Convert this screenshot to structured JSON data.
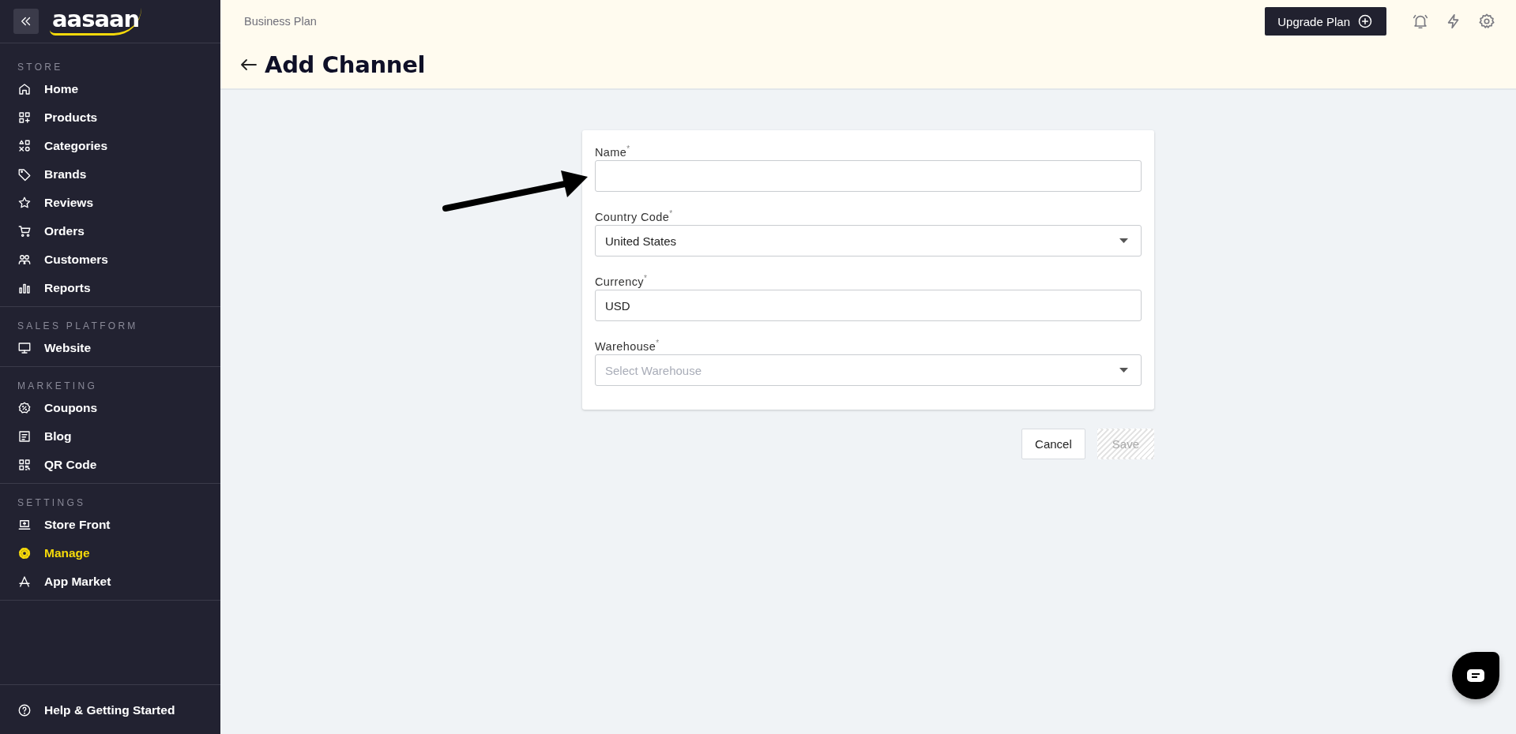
{
  "sidebar": {
    "logo": "aasaan",
    "sections": [
      {
        "title": "STORE",
        "items": [
          {
            "label": "Home",
            "selected": false
          },
          {
            "label": "Products",
            "selected": false
          },
          {
            "label": "Categories",
            "selected": false
          },
          {
            "label": "Brands",
            "selected": false
          },
          {
            "label": "Reviews",
            "selected": false
          },
          {
            "label": "Orders",
            "selected": false
          },
          {
            "label": "Customers",
            "selected": false
          },
          {
            "label": "Reports",
            "selected": false
          }
        ]
      },
      {
        "title": "SALES PLATFORM",
        "items": [
          {
            "label": "Website",
            "selected": false
          }
        ]
      },
      {
        "title": "MARKETING",
        "items": [
          {
            "label": "Coupons",
            "selected": false
          },
          {
            "label": "Blog",
            "selected": false
          },
          {
            "label": "QR Code",
            "selected": false
          }
        ]
      },
      {
        "title": "SETTINGS",
        "items": [
          {
            "label": "Store Front",
            "selected": false
          },
          {
            "label": "Manage",
            "selected": true
          },
          {
            "label": "App Market",
            "selected": false
          }
        ]
      }
    ],
    "help": {
      "label": "Help & Getting Started"
    }
  },
  "header": {
    "plan": "Business Plan",
    "title": "Add Channel",
    "upgrade_button": "Upgrade Plan"
  },
  "form": {
    "fields": [
      {
        "kind": "text",
        "label": "Name$^{*}$"
      },
      {
        "kind": "select",
        "label": "Country Code$^{*}$",
        "value": "United States"
      },
      {
        "kind": "text",
        "label": "Currency$^{*}$",
        "value": "USD"
      },
      {
        "kind": "select",
        "label": "Warehouse$^{*}$",
        "placeholder": "Select Warehouse"
      }
    ],
    "buttons": [
      {
        "label": "Cancel",
        "disabled": false
      },
      {
        "label": "Save",
        "disabled": true
      }
    ]
  }
}
